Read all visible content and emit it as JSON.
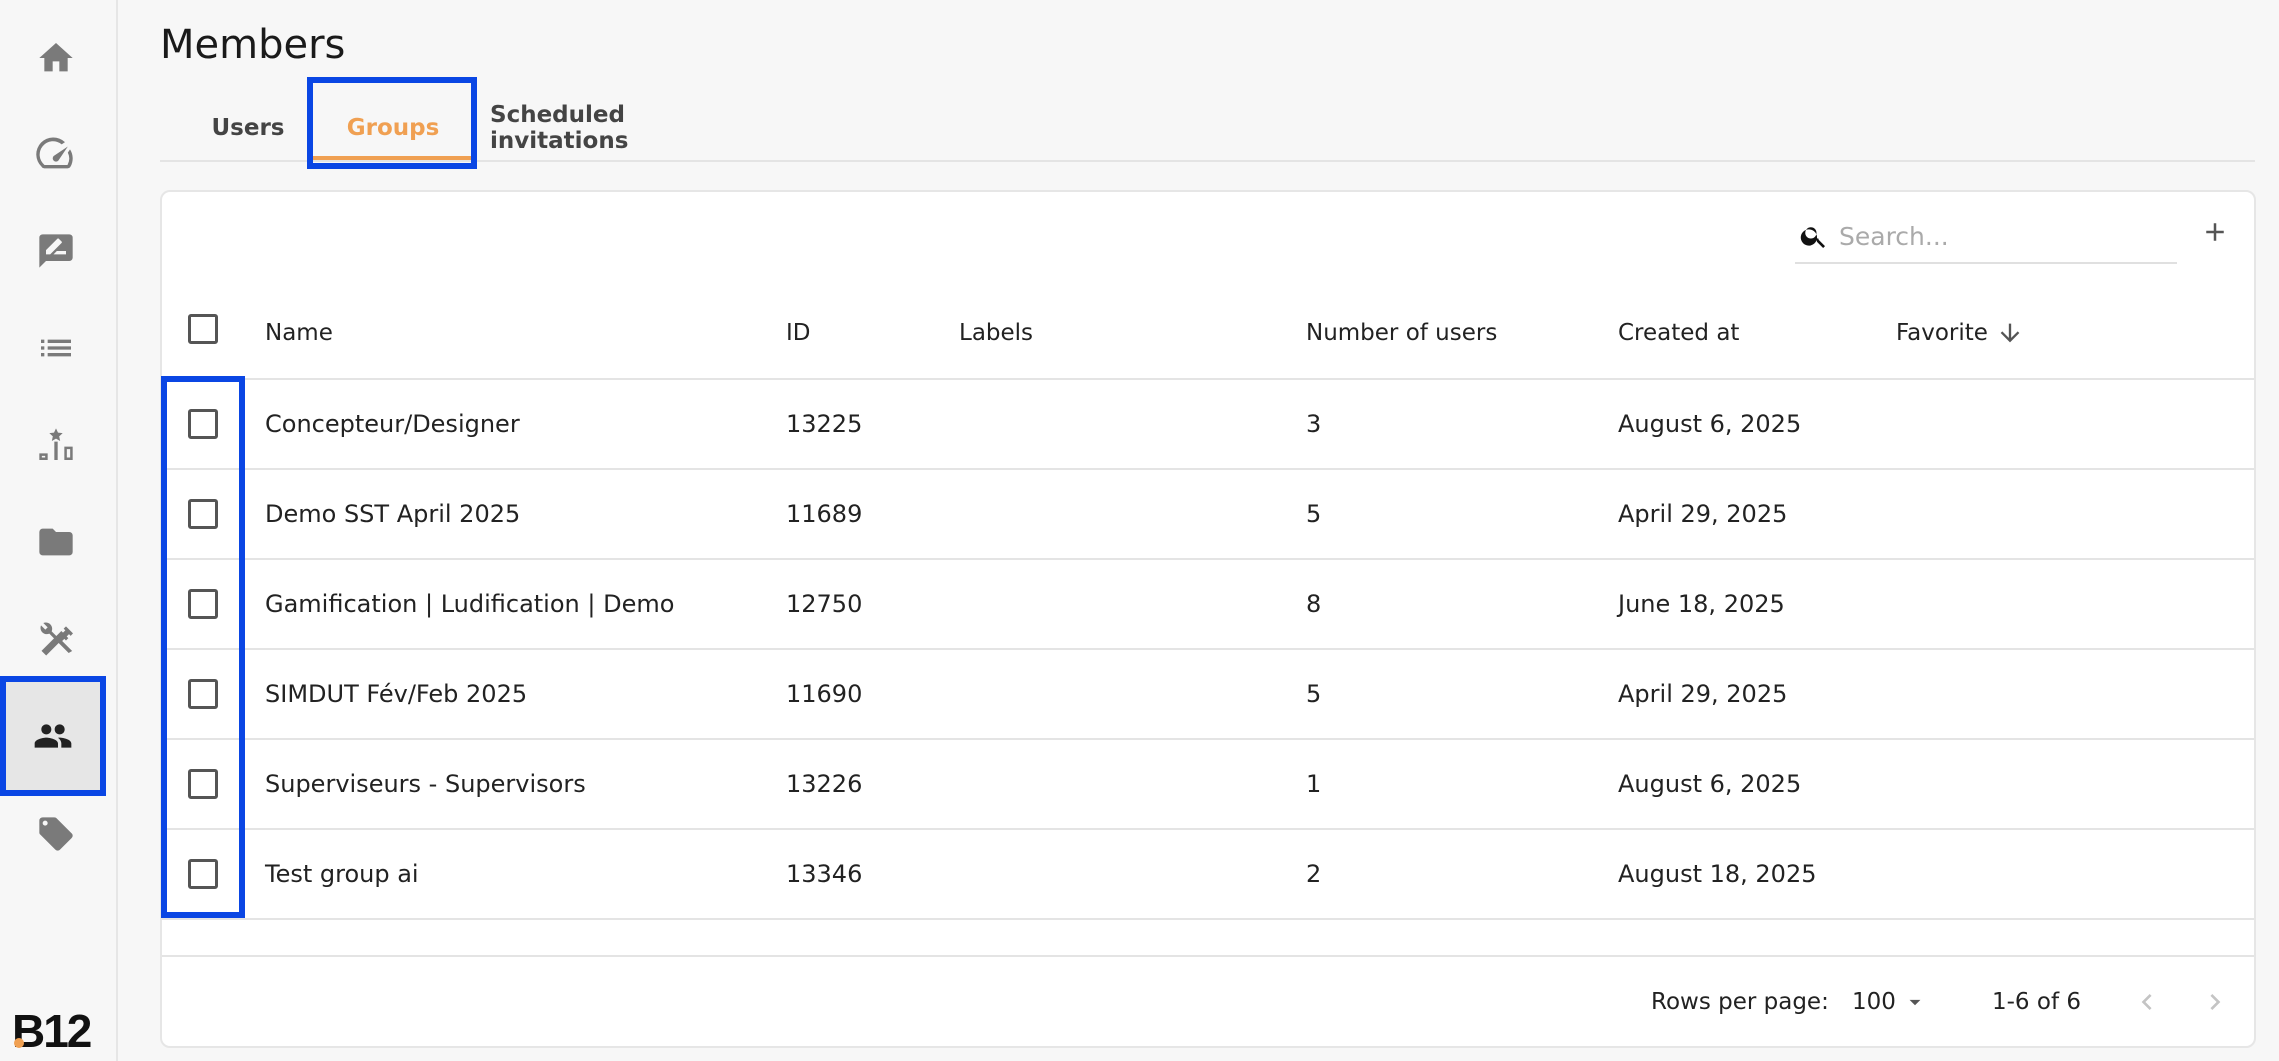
{
  "page": {
    "title": "Members"
  },
  "tabs": [
    {
      "label": "Users"
    },
    {
      "label": "Groups",
      "active": true
    },
    {
      "label": "Scheduled invitations"
    }
  ],
  "sidebar": {
    "items": [
      {
        "icon": "home-icon"
      },
      {
        "icon": "speedometer-icon"
      },
      {
        "icon": "rate-review-icon"
      },
      {
        "icon": "list-icon"
      },
      {
        "icon": "leaderboard-icon"
      },
      {
        "icon": "folder-icon"
      },
      {
        "icon": "tools-icon"
      },
      {
        "icon": "people-icon",
        "active": true
      },
      {
        "icon": "tag-icon"
      }
    ],
    "logo": "B12"
  },
  "search": {
    "placeholder": "Search..."
  },
  "table": {
    "columns": {
      "name": "Name",
      "id": "ID",
      "labels": "Labels",
      "users": "Number of users",
      "created": "Created at",
      "favorite": "Favorite"
    },
    "rows": [
      {
        "name": "Concepteur/Designer",
        "id": "13225",
        "labels": "",
        "users": "3",
        "created": "August 6, 2025"
      },
      {
        "name": "Demo SST April 2025",
        "id": "11689",
        "labels": "",
        "users": "5",
        "created": "April 29, 2025"
      },
      {
        "name": "Gamification | Ludification | Demo",
        "id": "12750",
        "labels": "",
        "users": "8",
        "created": "June 18, 2025"
      },
      {
        "name": "SIMDUT Fév/Feb 2025",
        "id": "11690",
        "labels": "",
        "users": "5",
        "created": "April 29, 2025"
      },
      {
        "name": "Superviseurs - Supervisors",
        "id": "13226",
        "labels": "",
        "users": "1",
        "created": "August 6, 2025"
      },
      {
        "name": "Test group ai",
        "id": "13346",
        "labels": "",
        "users": "2",
        "created": "August 18, 2025"
      }
    ]
  },
  "pagination": {
    "rows_per_page_label": "Rows per page:",
    "rows_per_page_value": "100",
    "range": "1-6 of 6"
  },
  "colors": {
    "accent": "#f0a052",
    "highlight": "#0a46e4"
  }
}
